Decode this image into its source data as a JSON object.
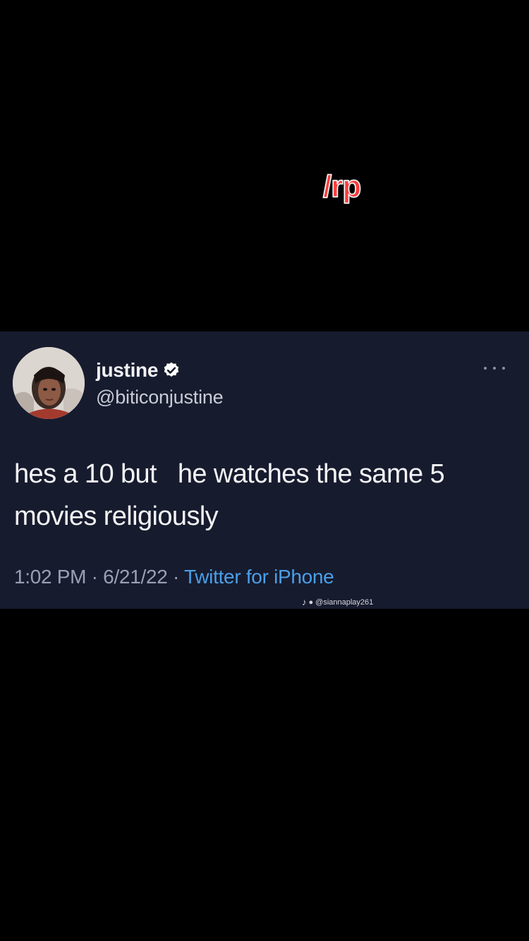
{
  "overlay": {
    "caption": "/rp"
  },
  "tweet": {
    "display_name": "justine",
    "handle": "@biticonjustine",
    "verified": true,
    "text_line1": "hes a 10 but   he watches the same 5",
    "text_line2": "movies religiously",
    "time": "1:02 PM",
    "separator": " · ",
    "date": "6/21/22",
    "source": "Twitter for iPhone"
  },
  "watermark": {
    "username": "@siannaplay261",
    "icon": "tiktok-icon"
  },
  "colors": {
    "card_background": "#171b2e",
    "page_background": "#000000",
    "caption_fill": "#ff3b3b",
    "link_blue": "#4a9fe8",
    "verified_badge": "#ffffff"
  }
}
